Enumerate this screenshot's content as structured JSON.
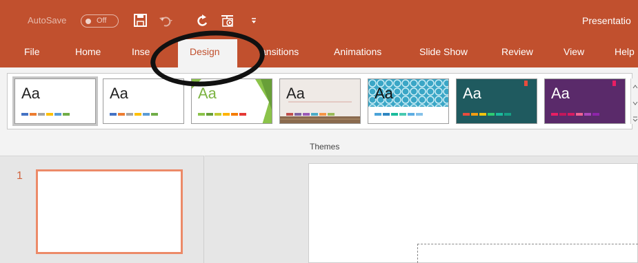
{
  "titlebar": {
    "autosave_label": "AutoSave",
    "autosave_state": "Off",
    "document_title": "Presentatio",
    "quick_access_icons": [
      "save-icon",
      "undo-icon",
      "redo-icon",
      "start-from-beginning-icon",
      "customize-qat-icon"
    ]
  },
  "ribbon": {
    "tabs": [
      {
        "label": "File"
      },
      {
        "label": "Home"
      },
      {
        "label": "Inse"
      },
      {
        "label": "Design"
      },
      {
        "label": "ansitions"
      },
      {
        "label": "Animations"
      },
      {
        "label": "Slide Show"
      },
      {
        "label": "Review"
      },
      {
        "label": "View"
      },
      {
        "label": "Help"
      }
    ],
    "active_tab": "Design",
    "themes_group_label": "Themes",
    "themes": [
      {
        "sample": "Aa",
        "background": "#ffffff",
        "text_color": "#222222",
        "swatches": [
          "#4472c4",
          "#ed7d31",
          "#a5a5a5",
          "#ffc000",
          "#5b9bd5",
          "#70ad47"
        ]
      },
      {
        "sample": "Aa",
        "background": "#ffffff",
        "text_color": "#222222",
        "swatches": [
          "#4472c4",
          "#ed7d31",
          "#a5a5a5",
          "#ffc000",
          "#5b9bd5",
          "#70ad47"
        ]
      },
      {
        "sample": "Aa",
        "background": "#ffffff",
        "text_color": "#7cb342",
        "swatches": [
          "#8bc34a",
          "#689f38",
          "#c0ca33",
          "#ffb300",
          "#f57c00",
          "#e53935"
        ]
      },
      {
        "sample": "Aa",
        "background": "#efeae6",
        "text_color": "#222222",
        "swatches": [
          "#c0504d",
          "#8064a2",
          "#9b59b6",
          "#4bacc6",
          "#f79646",
          "#9bbb59"
        ]
      },
      {
        "sample": "Aa",
        "background": "#3aa6c6",
        "text_color": "#111111",
        "swatches": [
          "#4aa3d8",
          "#2e86c1",
          "#1abc9c",
          "#48c9b0",
          "#5dade2",
          "#85c1e9"
        ]
      },
      {
        "sample": "Aa",
        "background": "#1f5a5f",
        "text_color": "#ffffff",
        "swatches": [
          "#e84c3d",
          "#f39c12",
          "#f1c40f",
          "#2ecc71",
          "#1abc9c",
          "#16a085"
        ]
      },
      {
        "sample": "Aa",
        "background": "#5a2a6a",
        "text_color": "#ffffff",
        "swatches": [
          "#e91e63",
          "#c2185b",
          "#d81b60",
          "#f06292",
          "#ab47bc",
          "#8e24aa"
        ]
      }
    ]
  },
  "slides_pane": {
    "slides": [
      {
        "number": "1"
      }
    ]
  },
  "colors": {
    "accent": "#c1502e",
    "thumb_border": "#ec8a68",
    "annotation": "#111111"
  }
}
